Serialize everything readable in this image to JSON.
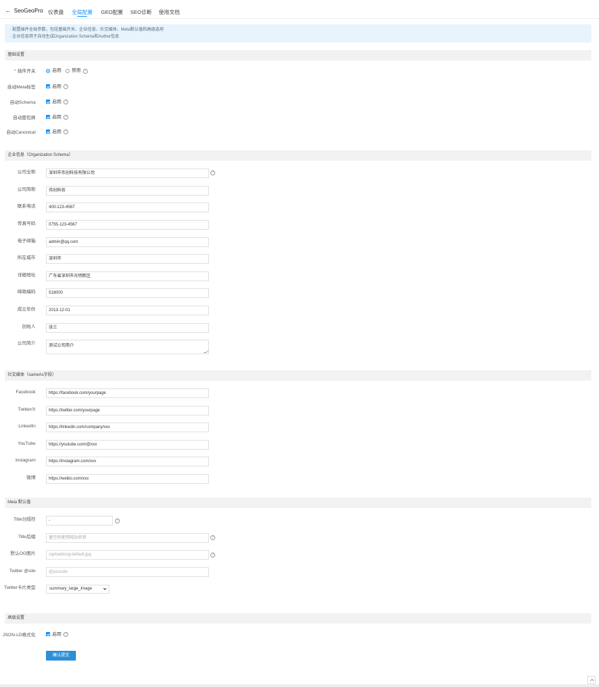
{
  "nav": {
    "back_icon": "arrow-left-icon",
    "brand": "SeoGeoPro",
    "tabs": [
      {
        "label": "仪表盘",
        "active": false
      },
      {
        "label": "全局配置",
        "active": true
      },
      {
        "label": "GEO配置",
        "active": false
      },
      {
        "label": "SEO诊断",
        "active": false
      },
      {
        "label": "使用文档",
        "active": false
      }
    ]
  },
  "notice": {
    "lines": [
      "· 配置插件全局参数，包括基础开关、企业信息、社交媒体、Meta默认值和高级选项",
      "· 企业信息用于自动生成Organization Schema和Author信息"
    ]
  },
  "basic": {
    "title": "基础设置",
    "plugin_switch": {
      "label": "插件开关",
      "required_mark": "*",
      "opt_on": "启用",
      "opt_off": "禁用",
      "selected": "启用"
    },
    "auto_meta": {
      "label": "自动Meta标签",
      "opt": "启用",
      "checked": true
    },
    "auto_schema": {
      "label": "自动Schema",
      "opt": "启用",
      "checked": true
    },
    "auto_breadcrumb": {
      "label": "自动面包屑",
      "opt": "启用",
      "checked": true
    },
    "auto_canonical": {
      "label": "自动Canonical",
      "opt": "启用",
      "checked": true
    }
  },
  "org": {
    "title": "企业信息（Organization Schema）",
    "fields": [
      {
        "label": "公司全称",
        "value": "深圳市伟创科技有限公司"
      },
      {
        "label": "公司简称",
        "value": "伟创科技"
      },
      {
        "label": "联系电话",
        "value": "400-123-4567"
      },
      {
        "label": "传真号码",
        "value": "0755-123-4567"
      },
      {
        "label": "电子邮箱",
        "value": "admin@qq.com"
      },
      {
        "label": "所在城市",
        "value": "深圳市"
      },
      {
        "label": "详细地址",
        "value": "广东省深圳市光明新区"
      },
      {
        "label": "邮政编码",
        "value": "518000"
      },
      {
        "label": "成立年份",
        "value": "2013-12-01"
      },
      {
        "label": "创始人",
        "value": "张三"
      }
    ],
    "intro": {
      "label": "公司简介",
      "value": "测试公司简介"
    }
  },
  "social": {
    "title": "社交媒体（sameAs字段）",
    "fields": [
      {
        "label": "Facebook",
        "value": "https://facebook.com/yourpage"
      },
      {
        "label": "Twitter/X",
        "value": "https://twitter.com/yourpage"
      },
      {
        "label": "LinkedIn",
        "value": "https://linkedin.com/company/xxx"
      },
      {
        "label": "YouTube",
        "value": "https://youtube.com/@xxx"
      },
      {
        "label": "Instagram",
        "value": "https://instagram.com/xxx"
      },
      {
        "label": "微博",
        "value": "https://weibo.com/xxx"
      }
    ]
  },
  "meta": {
    "title": "Meta 默认值",
    "title_sep": {
      "label": "Title分隔符",
      "value": "-"
    },
    "title_suffix": {
      "label": "Title后缀",
      "placeholder": "留空则使用网站名称"
    },
    "og_image": {
      "label": "默认OG图片",
      "placeholder": "/uploads/og-default.jpg"
    },
    "twitter_site": {
      "label": "Twitter @site",
      "placeholder": "@yoursite"
    },
    "twitter_card": {
      "label": "Twitter卡片类型",
      "value": "summary_large_image"
    }
  },
  "advanced": {
    "title": "高级设置",
    "jsonld_format": {
      "label": "JSON-LD格式化",
      "opt": "启用",
      "checked": true
    }
  },
  "submit_label": "确认提交",
  "colors": {
    "accent": "#1890ff",
    "notice_bg": "#e8f4fd",
    "button": "#2d8fd5"
  }
}
